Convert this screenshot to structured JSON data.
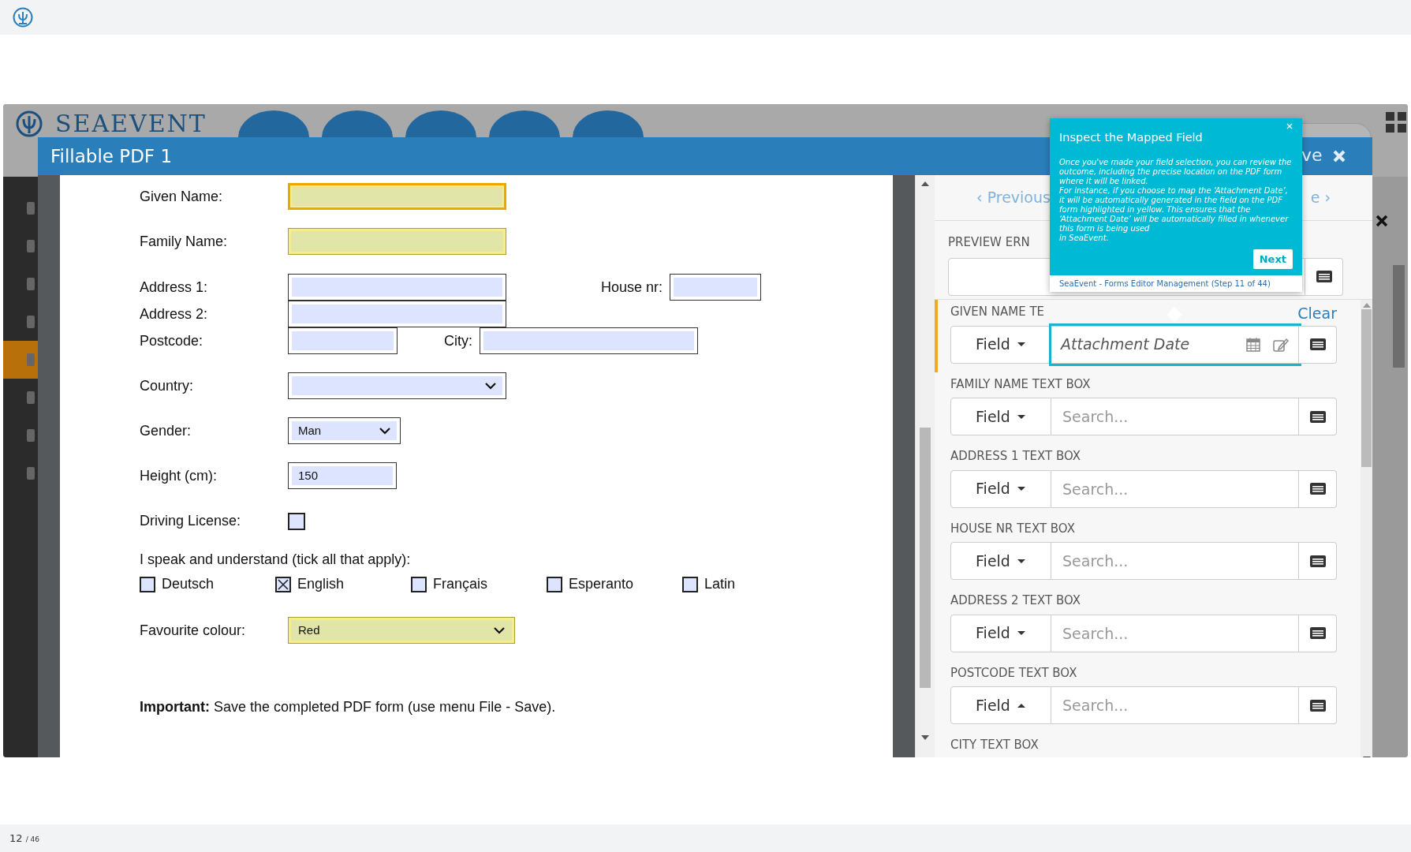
{
  "app": {
    "logo_text": "SEAEVENT",
    "sidebar": [
      {
        "selected": false
      },
      {
        "selected": false
      },
      {
        "selected": false
      },
      {
        "selected": false
      },
      {
        "selected": true
      },
      {
        "selected": false
      },
      {
        "selected": false
      },
      {
        "selected": false
      }
    ]
  },
  "modal": {
    "title": "Fillable PDF 1",
    "title_fragment": "ve"
  },
  "pdf_form": {
    "fields": [
      {
        "label": "Given Name:",
        "kind": "text",
        "highlighted": true,
        "focused": true
      },
      {
        "label": "Family Name:",
        "kind": "text",
        "highlighted": true,
        "focused": false
      },
      {
        "label": "Address 1:",
        "kind": "text",
        "highlighted": false,
        "focused": false
      },
      {
        "label": "House nr:",
        "kind": "text",
        "highlighted": false,
        "focused": false
      },
      {
        "label": "Address 2:",
        "kind": "text",
        "highlighted": false,
        "focused": false
      },
      {
        "label": "Postcode:",
        "kind": "text",
        "highlighted": false,
        "focused": false
      },
      {
        "label": "City:",
        "kind": "text",
        "highlighted": false,
        "focused": false
      },
      {
        "label": "Country:",
        "kind": "select",
        "highlighted": false,
        "focused": false
      },
      {
        "label": "Gender:",
        "kind": "select",
        "value": "Man",
        "highlighted": false,
        "focused": false
      },
      {
        "label": "Height (cm):",
        "kind": "text",
        "value": "150",
        "highlighted": false,
        "focused": false
      },
      {
        "label": "Driving License:",
        "kind": "checkbox",
        "checked": false
      },
      {
        "label": "I speak and understand (tick all that apply):",
        "kind": "checkbox_group",
        "options": [
          {
            "label": "Deutsch",
            "checked": false
          },
          {
            "label": "English",
            "checked": true
          },
          {
            "label": "Français",
            "checked": false
          },
          {
            "label": "Esperanto",
            "checked": false
          },
          {
            "label": "Latin",
            "checked": false
          }
        ]
      },
      {
        "label": "Favourite colour:",
        "kind": "select",
        "value": "Red",
        "highlighted": true,
        "focused": false
      }
    ],
    "note": "**Important:** Save the completed PDF form (use menu File - Save)."
  },
  "mapping_panel": {
    "previous": "‹ Previous",
    "next_fragment": "e ›",
    "preview_label": "PREVIEW ERN",
    "groups": [
      {
        "label": "GIVEN NAME TE",
        "selected": true,
        "clear": "Clear",
        "button": "Field",
        "open": false,
        "kind": "date",
        "value": "Attachment Date",
        "tour_target": true
      },
      {
        "label": "FAMILY NAME TEXT BOX",
        "selected": false,
        "button": "Field",
        "open": false,
        "kind": "search",
        "placeholder": "Search..."
      },
      {
        "label": "ADDRESS 1 TEXT BOX",
        "selected": false,
        "button": "Field",
        "open": false,
        "kind": "search",
        "placeholder": "Search..."
      },
      {
        "label": "HOUSE NR TEXT BOX",
        "selected": false,
        "button": "Field",
        "open": false,
        "kind": "search",
        "placeholder": "Search..."
      },
      {
        "label": "ADDRESS 2 TEXT BOX",
        "selected": false,
        "button": "Field",
        "open": false,
        "kind": "search",
        "placeholder": "Search..."
      },
      {
        "label": "POSTCODE TEXT BOX",
        "selected": false,
        "button": "Field",
        "open": true,
        "kind": "search",
        "placeholder": "Search..."
      },
      {
        "label": "CITY TEXT BOX",
        "selected": false
      }
    ]
  },
  "tour_popover": {
    "title": "Inspect the Mapped Field",
    "body": [
      "Once you've made your field selection, you can review the outcome, including the precise location on the PDF form where it will be linked.",
      "For instance, if you choose to map the ‘Attachment Date’, it will be automatically generated in the field on the PDF form highlighted in yellow. This ensures that the ‘Attachment Date’ will be automatically filled in whenever this form is being used",
      "in SeaEvent."
    ],
    "next": "Next",
    "footer": "SeaEvent - Forms Editor Management (Step 11 of 44)"
  },
  "pager": {
    "page": "12",
    "total": "/ 46"
  }
}
